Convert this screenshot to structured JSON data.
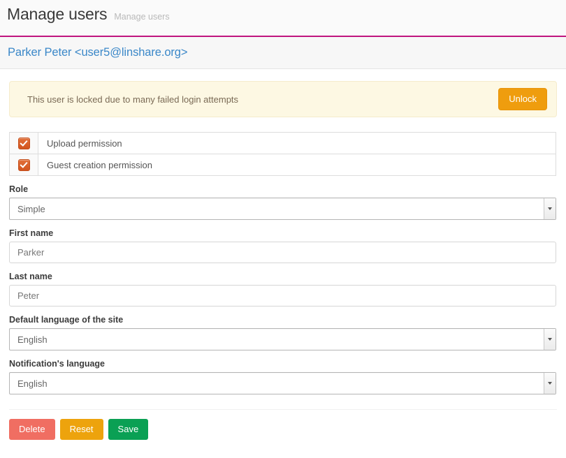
{
  "header": {
    "title": "Manage users",
    "subtitle": "Manage users",
    "accent_color": "#c0157e"
  },
  "user": {
    "heading": "Parker Peter <user5@linshare.org>",
    "heading_color": "#3a87c8"
  },
  "alert": {
    "message": "This user is locked due to many failed login attempts",
    "button_label": "Unlock",
    "background_color": "#fdf8e3",
    "button_color": "#ef9d0e"
  },
  "permissions": [
    {
      "label": "Upload permission",
      "checked": true
    },
    {
      "label": "Guest creation permission",
      "checked": true
    }
  ],
  "fields": {
    "role": {
      "label": "Role",
      "value": "Simple"
    },
    "first_name": {
      "label": "First name",
      "value": "Parker",
      "placeholder": "Parker"
    },
    "last_name": {
      "label": "Last name",
      "value": "Peter",
      "placeholder": "Peter"
    },
    "default_language": {
      "label": "Default language of the site",
      "value": "English"
    },
    "notification_language": {
      "label": "Notification's language",
      "value": "English"
    }
  },
  "actions": {
    "delete_label": "Delete",
    "reset_label": "Reset",
    "save_label": "Save",
    "delete_color": "#f06e62",
    "reset_color": "#eda30d",
    "save_color": "#0aa054"
  }
}
